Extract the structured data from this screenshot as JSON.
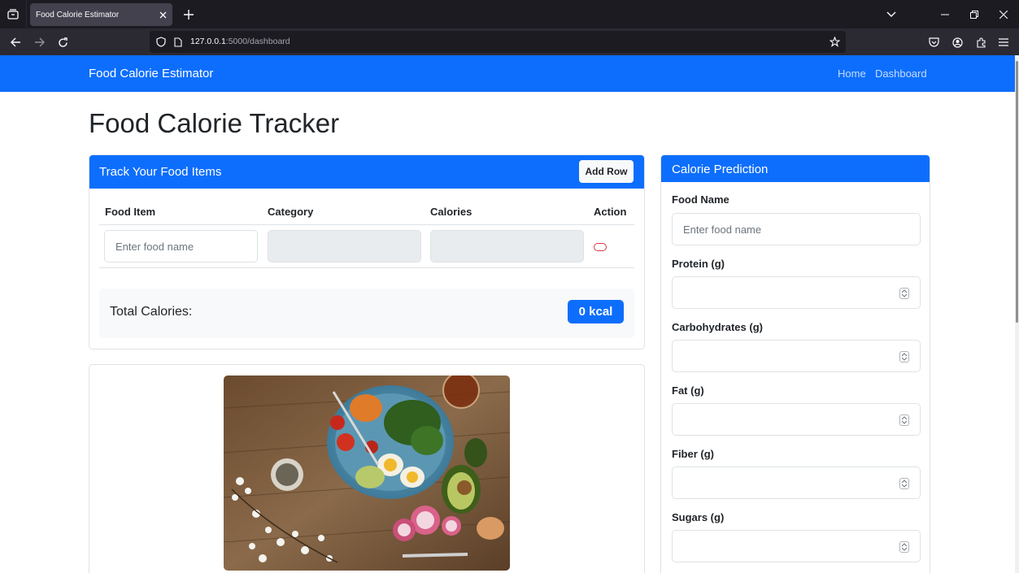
{
  "browser": {
    "tab_title": "Food Calorie Estimator",
    "url_host": "127.0.0.1",
    "url_rest": ":5000/dashboard"
  },
  "site": {
    "brand": "Food Calorie Estimator",
    "nav": [
      "Home",
      "Dashboard"
    ]
  },
  "page": {
    "title": "Food Calorie Tracker"
  },
  "tracker": {
    "title": "Track Your Food Items",
    "add_row_label": "Add Row",
    "columns": [
      "Food Item",
      "Category",
      "Calories",
      "Action"
    ],
    "row": {
      "food_placeholder": "Enter food name",
      "category": "",
      "calories": ""
    },
    "total_label": "Total Calories:",
    "total_value": "0 kcal"
  },
  "prediction": {
    "title": "Calorie Prediction",
    "fields": [
      {
        "label": "Food Name",
        "placeholder": "Enter food name",
        "type": "text"
      },
      {
        "label": "Protein (g)",
        "placeholder": "",
        "type": "number"
      },
      {
        "label": "Carbohydrates (g)",
        "placeholder": "",
        "type": "number"
      },
      {
        "label": "Fat (g)",
        "placeholder": "",
        "type": "number"
      },
      {
        "label": "Fiber (g)",
        "placeholder": "",
        "type": "number"
      },
      {
        "label": "Sugars (g)",
        "placeholder": "",
        "type": "number"
      }
    ]
  },
  "colors": {
    "primary": "#0d6efd",
    "danger": "#dc3545",
    "browser_dark": "#1c1b22"
  },
  "icons": [
    "tab-list-icon",
    "close-icon",
    "plus-icon",
    "back-arrow-icon",
    "forward-arrow-icon",
    "reload-icon",
    "shield-icon",
    "page-icon",
    "star-icon",
    "pocket-icon",
    "account-icon",
    "extensions-icon",
    "menu-icon",
    "chevron-down-icon",
    "minimize-icon",
    "restore-icon",
    "delete-icon"
  ]
}
